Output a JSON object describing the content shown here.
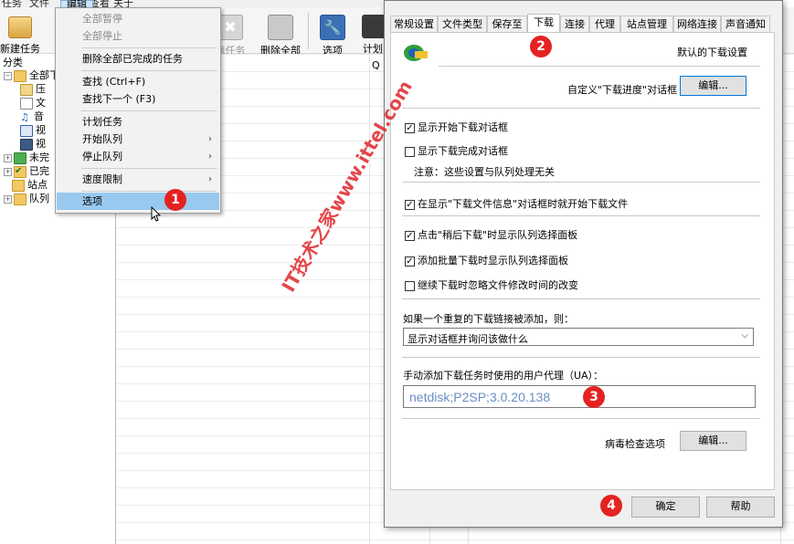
{
  "menubar": {
    "items": [
      "任务",
      "文件",
      "编辑",
      "查看",
      "关于"
    ]
  },
  "toolbar": {
    "new_task": "新建任务",
    "delete_task": "除任务",
    "delete_all": "删除全部",
    "options": "选项",
    "scheduler": "计划",
    "q_letter": "Q"
  },
  "tree": {
    "header": "分类",
    "items": [
      {
        "label": "全部下",
        "expander": "−"
      },
      {
        "label": "压",
        "expander": ""
      },
      {
        "label": "文",
        "expander": ""
      },
      {
        "label": "音",
        "expander": ""
      },
      {
        "label": "视",
        "expander": ""
      },
      {
        "label": "视",
        "expander": ""
      },
      {
        "label": "未完",
        "expander": "+"
      },
      {
        "label": "已完",
        "expander": "+"
      },
      {
        "label": "站点",
        "expander": ""
      },
      {
        "label": "队列",
        "expander": "+"
      }
    ]
  },
  "menu": {
    "items": [
      {
        "label": "全部暂停",
        "disabled": true
      },
      {
        "label": "全部停止",
        "disabled": true
      },
      {
        "label": "删除全部已完成的任务"
      },
      {
        "label": "查找 (Ctrl+F)"
      },
      {
        "label": "查找下一个 (F3)"
      },
      {
        "label": "计划任务"
      },
      {
        "label": "开始队列",
        "submenu": true
      },
      {
        "label": "停止队列",
        "submenu": true
      },
      {
        "label": "速度限制",
        "submenu": true
      },
      {
        "label": "选项",
        "highlighted": true
      }
    ]
  },
  "dialog": {
    "tabs": [
      "常规设置",
      "文件类型",
      "保存至",
      "下载",
      "连接",
      "代理",
      "站点管理",
      "网络连接",
      "声音通知"
    ],
    "active_tab": "下载",
    "default_download_settings": "默认的下载设置",
    "customize_dialog_label": "自定义\"下载进度\"对话框",
    "edit_button": "编辑...",
    "show_start_dialog": {
      "label": "显示开始下载对话框",
      "checked": true
    },
    "show_complete_dialog": {
      "label": "显示下载完成对话框",
      "checked": false
    },
    "note": "注意：这些设置与队列处理无关",
    "show_file_info_before": {
      "label": "在显示\"下载文件信息\"对话框时就开始下载文件",
      "checked": true
    },
    "show_queue_panel_later": {
      "label": "点击\"稍后下载\"时显示队列选择面板",
      "checked": true
    },
    "show_queue_panel_batch": {
      "label": "添加批量下载时显示队列选择面板",
      "checked": true
    },
    "resume_ignore_time": {
      "label": "继续下载时忽略文件修改时间的改变",
      "checked": false
    },
    "duplicate_label": "如果一个重复的下载链接被添加，则：",
    "duplicate_option": "显示对话框并询问该做什么",
    "ua_label": "手动添加下载任务时使用的用户代理（UA）：",
    "ua_value": "netdisk;P2SP;3.0.20.138",
    "virus_check_label": "病毒检查选项",
    "virus_edit_button": "编辑...",
    "ok_button": "确定",
    "help_button": "帮助"
  },
  "badges": [
    "1",
    "2",
    "3",
    "4"
  ],
  "watermark": "IT技术之家www.ittel.com",
  "colors": {
    "badge": "#e52222",
    "menu_highlight": "#99c9ef",
    "ua_text": "#6a8ec4",
    "watermark": "#e0262b"
  }
}
